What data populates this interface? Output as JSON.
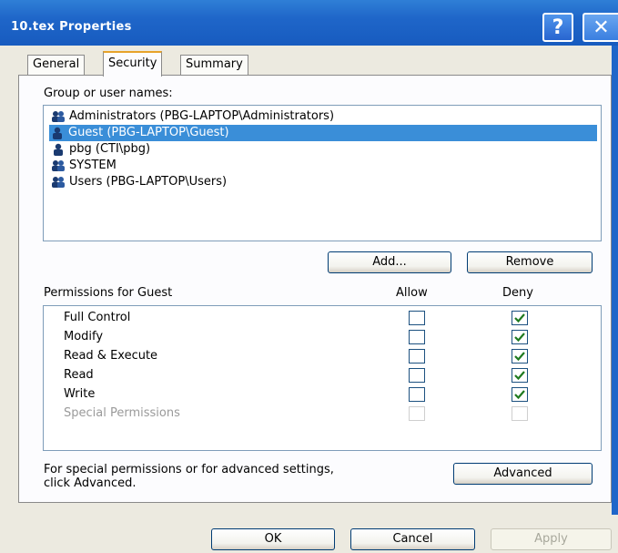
{
  "window": {
    "title": "10.tex Properties",
    "help_symbol": "?",
    "close_symbol": "✕"
  },
  "tabs": [
    {
      "label": "General"
    },
    {
      "label": "Security"
    },
    {
      "label": "Summary"
    }
  ],
  "security": {
    "group_label": "Group or user names:",
    "users": [
      {
        "name": "Administrators (PBG-LAPTOP\\Administrators)",
        "icon": "group-users-icon",
        "selected": false
      },
      {
        "name": "Guest (PBG-LAPTOP\\Guest)",
        "icon": "single-user-icon",
        "selected": true
      },
      {
        "name": "pbg (CTI\\pbg)",
        "icon": "single-user-icon",
        "selected": false
      },
      {
        "name": "SYSTEM",
        "icon": "group-users-icon",
        "selected": false
      },
      {
        "name": "Users (PBG-LAPTOP\\Users)",
        "icon": "group-users-icon",
        "selected": false
      }
    ],
    "add_label": "Add...",
    "remove_label": "Remove",
    "permissions_label": "Permissions for Guest",
    "allow_header": "Allow",
    "deny_header": "Deny",
    "permissions": [
      {
        "name": "Full Control",
        "allow": false,
        "deny": true,
        "enabled": true
      },
      {
        "name": "Modify",
        "allow": false,
        "deny": true,
        "enabled": true
      },
      {
        "name": "Read & Execute",
        "allow": false,
        "deny": true,
        "enabled": true
      },
      {
        "name": "Read",
        "allow": false,
        "deny": true,
        "enabled": true
      },
      {
        "name": "Write",
        "allow": false,
        "deny": true,
        "enabled": true
      },
      {
        "name": "Special Permissions",
        "allow": false,
        "deny": false,
        "enabled": false
      }
    ],
    "advanced_text_line1": "For special permissions or for advanced settings,",
    "advanced_text_line2": "click Advanced.",
    "advanced_label": "Advanced"
  },
  "footer": {
    "ok_label": "OK",
    "cancel_label": "Cancel",
    "apply_label": "Apply"
  },
  "colors": {
    "titlebar": "#1f66c9",
    "selection": "#3a8ed8",
    "active_tab_accent": "#e7a32a",
    "checkbox_check": "#1f7a1f"
  }
}
